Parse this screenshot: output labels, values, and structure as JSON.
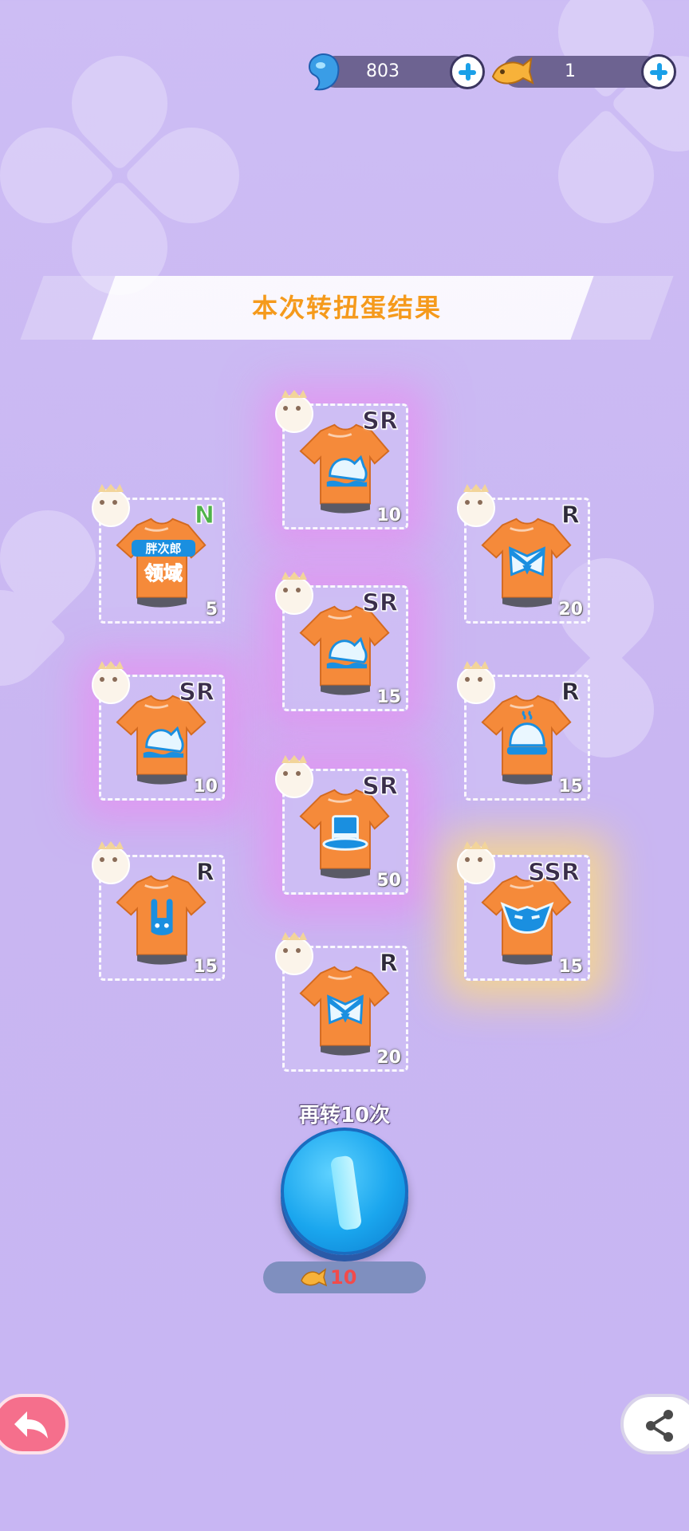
{
  "currency": {
    "gems": "803",
    "fish": "1"
  },
  "title": "本次转扭蛋结果",
  "items": [
    {
      "rarity": "SR",
      "qty": "10",
      "design": "cloud"
    },
    {
      "rarity": "N",
      "qty": "5",
      "design": "text",
      "shirt_text_1": "胖次郎",
      "shirt_text_2": "领域"
    },
    {
      "rarity": "R",
      "qty": "20",
      "design": "sailor"
    },
    {
      "rarity": "SR",
      "qty": "15",
      "design": "cloud"
    },
    {
      "rarity": "SR",
      "qty": "10",
      "design": "cloud"
    },
    {
      "rarity": "R",
      "qty": "15",
      "design": "bun"
    },
    {
      "rarity": "SR",
      "qty": "50",
      "design": "tophat"
    },
    {
      "rarity": "R",
      "qty": "15",
      "design": "bunny"
    },
    {
      "rarity": "SSR",
      "qty": "15",
      "design": "mask"
    },
    {
      "rarity": "R",
      "qty": "20",
      "design": "sailor"
    }
  ],
  "spin_again_label": "再转10次",
  "cost": "10",
  "colors": {
    "accent_blue": "#1aa6ee",
    "title_orange": "#f59a1c",
    "cost_red": "#f24b4b"
  }
}
